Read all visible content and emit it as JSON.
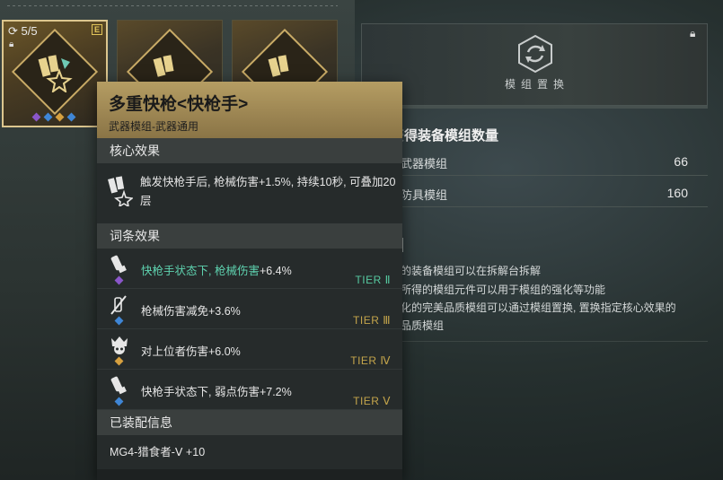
{
  "module_cards": [
    {
      "counter": "5/5",
      "rarity": "E",
      "selected": true
    },
    {
      "selected": false
    },
    {
      "selected": false
    }
  ],
  "tooltip": {
    "title": "多重快枪<快枪手>",
    "subtitle": "武器模组-武器通用",
    "core_section_label": "核心效果",
    "core_effect": "触发快枪手后, 枪械伤害+1.5%, 持续10秒, 可叠加20层",
    "affix_section_label": "词条效果",
    "affixes": [
      {
        "text": "快枪手状态下, 枪械伤害+6.4%",
        "text_main": "快枪手状态下, 枪械伤害",
        "text_value": "+6.4%",
        "tier": "TIER Ⅱ",
        "dot_color": "#8a56c9",
        "icon": "bullet-icon",
        "highlight": true
      },
      {
        "text": "枪械伤害减免+3.6%",
        "tier": "TIER Ⅲ",
        "dot_color": "#3f86d6",
        "icon": "shield-slash-icon",
        "highlight": false
      },
      {
        "text": "对上位者伤害+6.0%",
        "tier": "TIER Ⅳ",
        "dot_color": "#d6a03f",
        "icon": "boss-skull-icon",
        "highlight": false
      },
      {
        "text": "快枪手状态下, 弱点伤害+7.2%",
        "tier": "TIER Ⅴ",
        "dot_color": "#3f86d6",
        "icon": "bullet-icon",
        "highlight": false
      }
    ],
    "equip_section_label": "已装配信息",
    "equip_info": "MG4-猎食者-Ⅴ +10"
  },
  "right_panel": {
    "swap_label": "模组置换",
    "section_title": "可获得装备模组数量",
    "title_visible_part": "得装备模组数量",
    "stats": [
      {
        "label": "武器模组",
        "value": "66"
      },
      {
        "label": "防具模组",
        "value": "160"
      }
    ],
    "info_lines": [
      "的装备模组可以在拆解台拆解",
      "所得的模组元件可以用于模组的强化等功能",
      "化的完美品质模组可以通过模组置换, 置换指定核心效果的",
      "品质模组"
    ]
  },
  "colors": {
    "accent_gold": "#b59d63",
    "tier_green": "#56c9a0"
  }
}
